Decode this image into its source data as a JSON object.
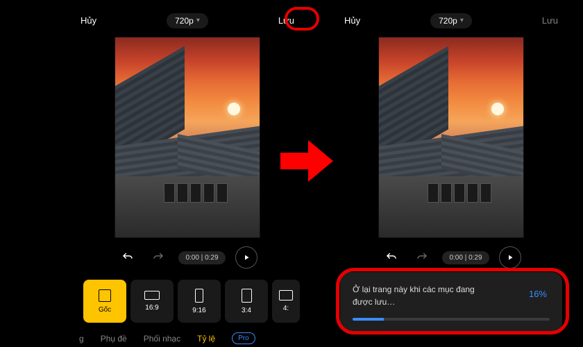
{
  "left": {
    "cancel": "Hủy",
    "quality": "720p",
    "save": "Lưu",
    "time": "0:00 | 0:29",
    "ratios": [
      {
        "label": "Gốc"
      },
      {
        "label": "16:9"
      },
      {
        "label": "9:16"
      },
      {
        "label": "3:4"
      },
      {
        "label": "4:"
      }
    ],
    "tabs": {
      "t0": "g",
      "t1": "Phụ đề",
      "t2": "Phối nhạc",
      "t3": "Tỷ lệ",
      "pro": "Pro"
    }
  },
  "right": {
    "cancel": "Hủy",
    "quality": "720p",
    "save": "Lưu",
    "time": "0:00 | 0:29",
    "progress": {
      "text": "Ở lại trang này khi các mục đang được lưu…",
      "percent": "16%"
    }
  }
}
